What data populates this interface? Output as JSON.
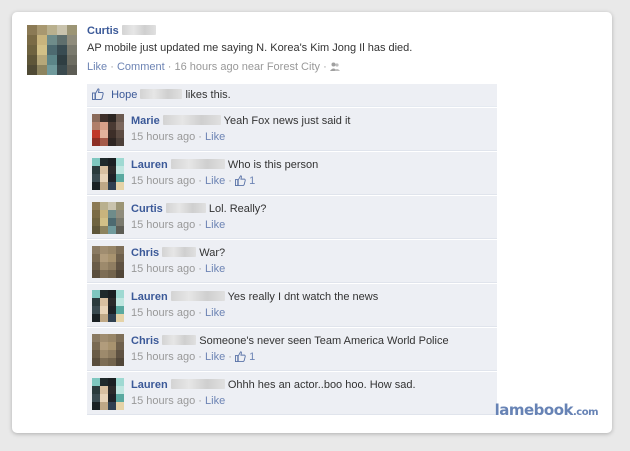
{
  "post": {
    "author": "Curtis",
    "text": "AP mobile just updated me saying N. Korea's Kim Jong Il has died.",
    "like_label": "Like",
    "comment_label": "Comment",
    "time": "16 hours ago",
    "location": "near Forest City",
    "likes_name": "Hope",
    "likes_suffix": "likes this."
  },
  "comments": [
    {
      "author": "Marie",
      "text": "Yeah Fox news just said it",
      "time": "15 hours ago",
      "like_label": "Like",
      "likes": ""
    },
    {
      "author": "Lauren",
      "text": "Who is this person",
      "time": "15 hours ago",
      "like_label": "Like",
      "likes": "1"
    },
    {
      "author": "Curtis",
      "text": "Lol. Really?",
      "time": "15 hours ago",
      "like_label": "Like",
      "likes": ""
    },
    {
      "author": "Chris",
      "text": "War?",
      "time": "15 hours ago",
      "like_label": "Like",
      "likes": ""
    },
    {
      "author": "Lauren",
      "text": "Yes really I dnt watch the news",
      "time": "15 hours ago",
      "like_label": "Like",
      "likes": ""
    },
    {
      "author": "Chris",
      "text": "Someone's never seen Team America World Police",
      "time": "15 hours ago",
      "like_label": "Like",
      "likes": "1"
    },
    {
      "author": "Lauren",
      "text": "Ohhh hes an actor..boo hoo. How sad.",
      "time": "15 hours ago",
      "like_label": "Like",
      "likes": ""
    }
  ],
  "watermark": {
    "brand": "lamebook",
    "tld": ".com"
  },
  "colors": {
    "link": "#3b5998",
    "meta": "#999999",
    "comment_bg": "#edeff4",
    "watermark": "#6783b5"
  }
}
